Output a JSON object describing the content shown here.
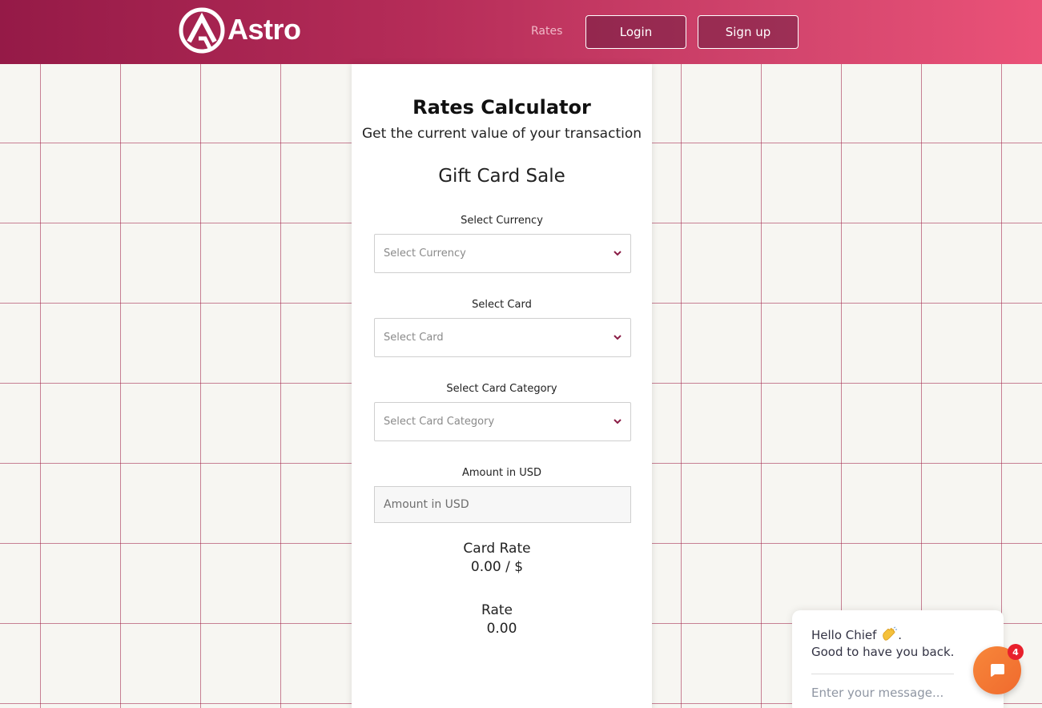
{
  "header": {
    "logo_text": "Astro",
    "nav": {
      "rates": "Rates",
      "login": "Login",
      "signup": "Sign up"
    }
  },
  "calculator": {
    "title": "Rates Calculator",
    "subtitle": "Get the current value of your transaction",
    "section_title": "Gift Card Sale",
    "fields": [
      {
        "label": "Select Currency",
        "placeholder": "Select Currency"
      },
      {
        "label": "Select Card",
        "placeholder": "Select Card"
      },
      {
        "label": "Select Card Category",
        "placeholder": "Select Card Category"
      }
    ],
    "amount": {
      "label": "Amount in USD",
      "placeholder": "Amount in USD"
    },
    "card_rate": {
      "label": "Card Rate",
      "value": "0.00 / $"
    },
    "rate": {
      "label": "Rate",
      "value": "0.00"
    }
  },
  "chat": {
    "greeting_line1": "Hello Chief",
    "greeting_line2": "Good to have you back.",
    "input_placeholder": "Enter your message...",
    "badge_count": "4"
  },
  "colors": {
    "header_start": "#951a47",
    "header_end": "#eb5278",
    "accent": "#8a1c45",
    "chat_launcher": "#f7873a",
    "badge": "#e8202c"
  }
}
